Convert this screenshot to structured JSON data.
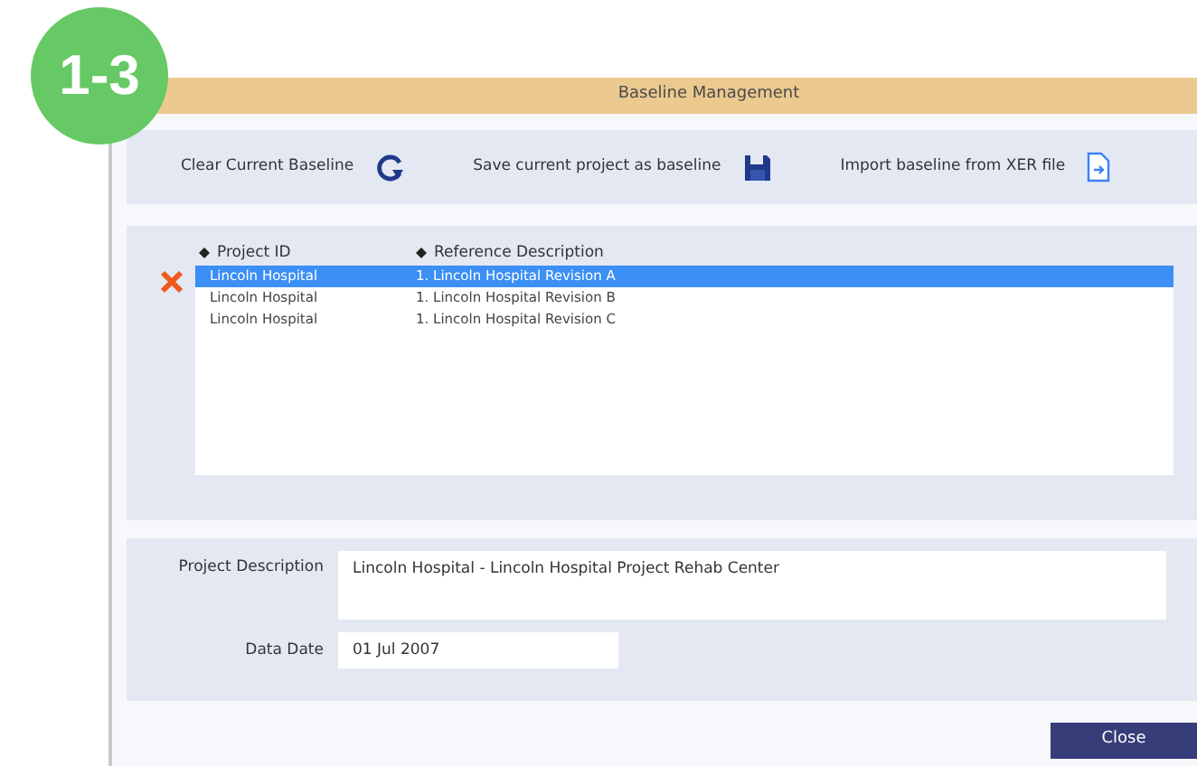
{
  "badge": "1-3",
  "window": {
    "title": "Baseline Management"
  },
  "toolbar": [
    {
      "label": "Clear Current Baseline",
      "kind": "refresh"
    },
    {
      "label": "Save current project as baseline",
      "kind": "save"
    },
    {
      "label": "Import baseline from XER file",
      "kind": "import"
    }
  ],
  "table": {
    "columns": [
      "Project ID",
      "Reference Description"
    ],
    "rows": [
      {
        "cells": [
          "Lincoln Hospital",
          "1. Lincoln Hospital Revision A"
        ],
        "selected": true
      },
      {
        "cells": [
          "Lincoln Hospital",
          "1. Lincoln Hospital Revision B"
        ],
        "selected": false
      },
      {
        "cells": [
          "Lincoln Hospital",
          "1. Lincoln Hospital Revision C"
        ],
        "selected": false
      }
    ]
  },
  "project_description": {
    "label": "Project Description",
    "value": "Lincoln Hospital - Lincoln Hospital Project Rehab Center"
  },
  "data_date": {
    "label": "Data Date",
    "value": "01 Jul 2007"
  },
  "buttons": [
    "Close"
  ]
}
